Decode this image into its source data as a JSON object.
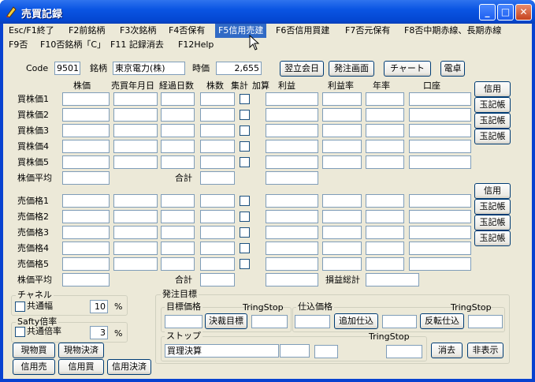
{
  "window": {
    "title": "売買記録"
  },
  "menu": [
    {
      "label": "Esc/F1終了",
      "selected": false
    },
    {
      "label": "F2前銘柄",
      "selected": false
    },
    {
      "label": "F3次銘柄",
      "selected": false
    },
    {
      "label": "F4否保有",
      "selected": false
    },
    {
      "label": "F5信用売建",
      "selected": true
    },
    {
      "label": "F6否信用買建",
      "selected": false
    },
    {
      "label": "F7否元保有",
      "selected": false
    },
    {
      "label": "F8否中期赤線、長期赤線",
      "selected": false
    },
    {
      "label": "F9否",
      "selected": false
    },
    {
      "label": "F10否銘柄「C」",
      "selected": false
    },
    {
      "label": "F11 記録消去",
      "selected": false
    },
    {
      "label": "F12Help",
      "selected": false
    }
  ],
  "header": {
    "code_label": "Code",
    "code_value": "9501",
    "name_label": "銘柄",
    "name_value": "東京電力(株)",
    "price_label": "時価",
    "price_value": "2,655",
    "btn_next_day": "翌立会日",
    "btn_order_screen": "発注画面",
    "btn_chart": "チャート",
    "btn_calc": "電卓"
  },
  "columns": [
    "株価",
    "売買年月日",
    "経過日数",
    "株数",
    "集計",
    "加算",
    "利益",
    "利益率",
    "年率",
    "口座"
  ],
  "buy": {
    "rows": [
      "買株価1",
      "買株価2",
      "買株価3",
      "買株価4",
      "買株価5"
    ],
    "avg_label": "株価平均",
    "total_label": "合計",
    "side_buttons": [
      "信用",
      "玉記帳",
      "玉記帳",
      "玉記帳"
    ]
  },
  "sell": {
    "rows": [
      "売価格1",
      "売価格2",
      "売価格3",
      "売価格4",
      "売価格5"
    ],
    "avg_label": "株価平均",
    "total_label": "合計",
    "pnl_label": "損益総計",
    "side_buttons": [
      "信用",
      "玉記帳",
      "玉記帳",
      "玉記帳"
    ]
  },
  "channel": {
    "title": "チャネル",
    "check_label": "共通幅",
    "value": "10",
    "unit": "%"
  },
  "safety": {
    "title": "Safty倍率",
    "check_label": "共通倍率",
    "value": "3",
    "unit": "%"
  },
  "trade_buttons": [
    "現物買",
    "現物決済",
    "信用売",
    "信用買",
    "信用決済"
  ],
  "order": {
    "title": "発注目標",
    "target_title": "目標価格",
    "tring1": "TringStop",
    "btn_settle_target": "決裁目標",
    "entry_title": "仕込価格",
    "tring2": "TringStop",
    "btn_add_entry": "追加仕込",
    "btn_reverse_entry": "反転仕込",
    "stop_title": "ストップ",
    "tring3": "TringStop",
    "stop_value": "買理決算",
    "btn_erase": "消去",
    "btn_hide": "非表示"
  },
  "colors": {
    "titlebar": "#0a55e3",
    "client": "#ece9d8",
    "menu_selected": "#316ac5"
  }
}
